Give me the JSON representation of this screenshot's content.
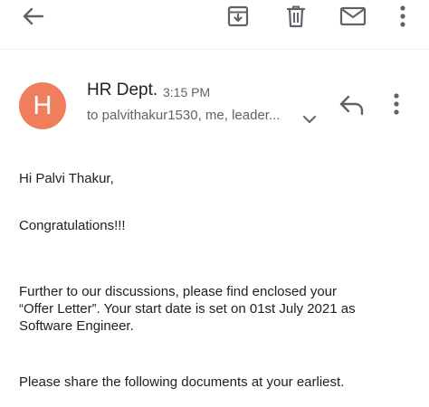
{
  "toolbar": {
    "icons": [
      "back-arrow-icon",
      "archive-icon",
      "delete-icon",
      "mark-unread-icon",
      "more-vert-icon"
    ]
  },
  "email": {
    "avatar_letter": "H",
    "avatar_color": "#f07e5d",
    "sender": "HR Dept.",
    "time": "3:15 PM",
    "recipients": "to palvithakur1530, me, leader...",
    "body": {
      "greeting": "Hi Palvi Thakur,",
      "congrats": "Congratulations!!!",
      "para1_line1": "Further to our discussions, please find enclosed your",
      "para1_line2": "“Offer Letter”. Your start date is set on 01st July 2021 as",
      "para1_line3": "Software Engineer.",
      "para2": "Please share the following documents at your earliest."
    }
  },
  "colors": {
    "icon": "#5f6368",
    "text": "#202124",
    "secondary_text": "#5f6368"
  }
}
